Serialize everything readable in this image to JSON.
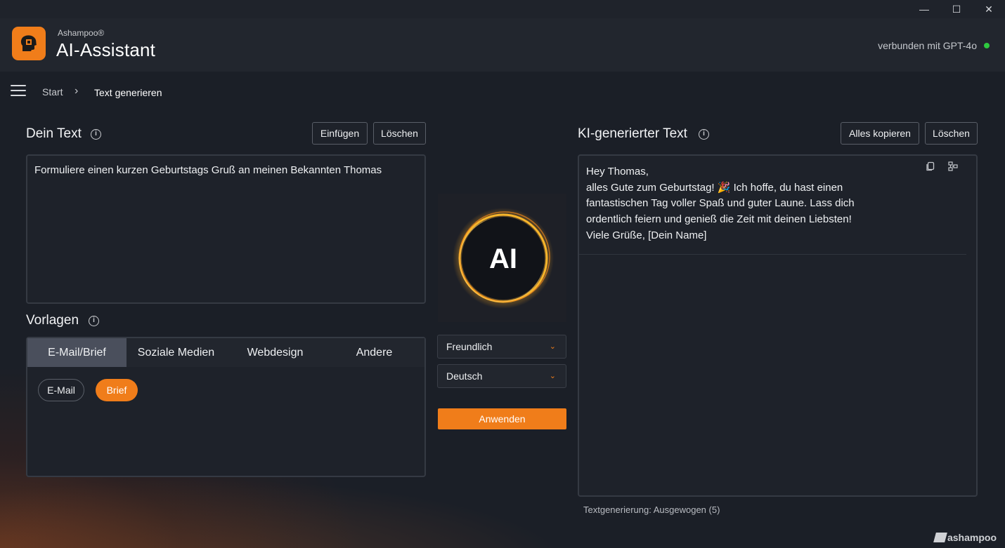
{
  "window": {
    "minimize": "—",
    "maximize": "☐",
    "close": "✕"
  },
  "header": {
    "brand_small": "Ashampoo®",
    "app_title": "AI-Assistant",
    "status": "verbunden mit GPT-4o",
    "status_color": "#2ec93f"
  },
  "breadcrumb": {
    "start": "Start",
    "separator": "›",
    "current": "Text generieren"
  },
  "input_section": {
    "title": "Dein Text",
    "insert_button": "Einfügen",
    "clear_button": "Löschen",
    "text": "Formuliere einen kurzen Geburtstags Gruß an meinen Bekannten Thomas"
  },
  "templates": {
    "title": "Vorlagen",
    "tabs": [
      {
        "label": "E-Mail/Brief",
        "active": true
      },
      {
        "label": "Soziale Medien",
        "active": false
      },
      {
        "label": "Webdesign",
        "active": false
      },
      {
        "label": "Andere",
        "active": false
      }
    ],
    "chips": [
      {
        "label": "E-Mail",
        "selected": false
      },
      {
        "label": "Brief",
        "selected": true
      }
    ]
  },
  "center": {
    "ai_label": "AI",
    "tone": "Freundlich",
    "language": "Deutsch",
    "apply_button": "Anwenden"
  },
  "output_section": {
    "title": "KI-generierter Text",
    "copy_all_button": "Alles kopieren",
    "clear_button": "Löschen",
    "lines": [
      "Hey Thomas,",
      "alles Gute zum Geburtstag! 🎉 Ich hoffe, du hast einen",
      "fantastischen Tag voller Spaß und guter Laune. Lass dich",
      "ordentlich feiern und genieß die Zeit mit deinen Liebsten!",
      "Viele Grüße, [Dein Name]"
    ],
    "footer": "Textgenerierung: Ausgewogen (5)"
  },
  "brand_footer": "ashampoo",
  "accent_color": "#f07d1a"
}
